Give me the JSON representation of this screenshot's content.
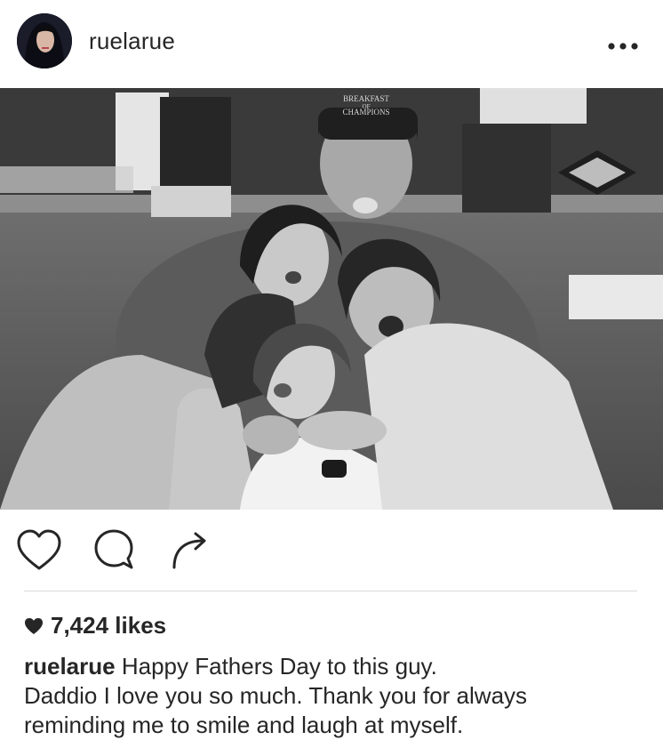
{
  "post": {
    "username": "ruelarue",
    "more_icon": "ellipsis-icon",
    "photo_cap_text": [
      "BREAKFAST",
      "OF",
      "CHAMPIONS"
    ],
    "actions": [
      "heart-icon",
      "comment-icon",
      "share-icon"
    ],
    "likes_text": "7,424 likes",
    "caption_user": "ruelarue",
    "caption_line1": "Happy Fathers Day to this guy.",
    "caption_line2": "Daddio I love you so much. Thank you for always",
    "caption_line3": "reminding me to smile and laugh at myself."
  }
}
